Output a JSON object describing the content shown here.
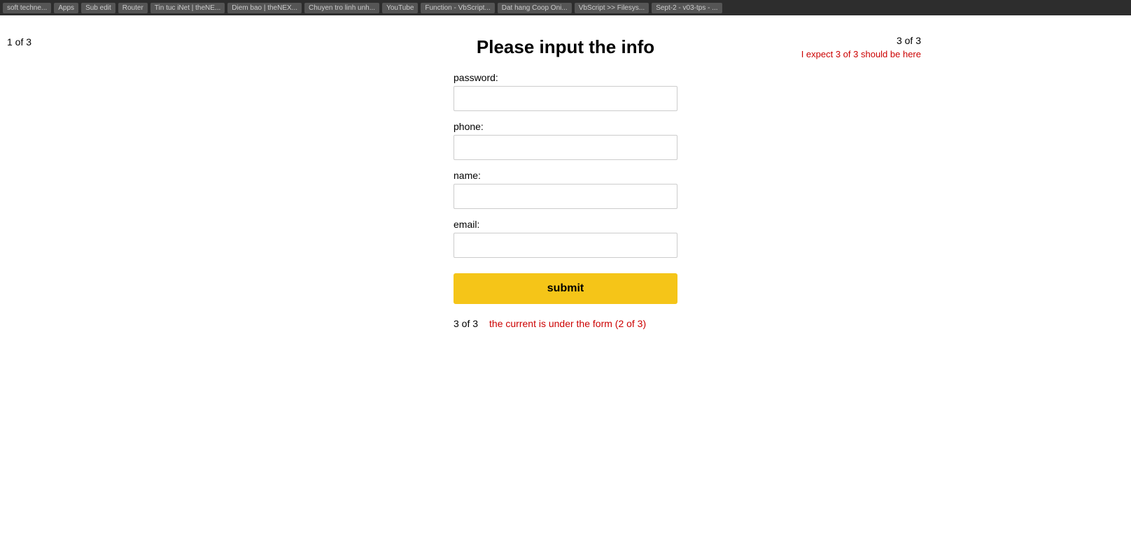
{
  "browser": {
    "tabs": [
      "soft techne...",
      "Apps",
      "Sub edit",
      "Router",
      "Tin tuc iNet | theNE...",
      "Diem bao | theNEX...",
      "Chuyen tro linh unh...",
      "YouTube",
      "Function - VbScript...",
      "Dat hang Coop Oni...",
      "VbScript >> Filesys...",
      "Sept-2 - v03-tps - ..."
    ]
  },
  "page": {
    "top_left_counter": "1 of 3",
    "top_right_count": "3 of 3",
    "top_right_expect": "I expect 3 of 3 should be here",
    "form_title": "Please input the info",
    "password_label": "password:",
    "phone_label": "phone:",
    "name_label": "name:",
    "email_label": "email:",
    "submit_label": "submit",
    "bottom_count": "3 of 3",
    "bottom_note": "the current is under  the form (2 of 3)"
  }
}
